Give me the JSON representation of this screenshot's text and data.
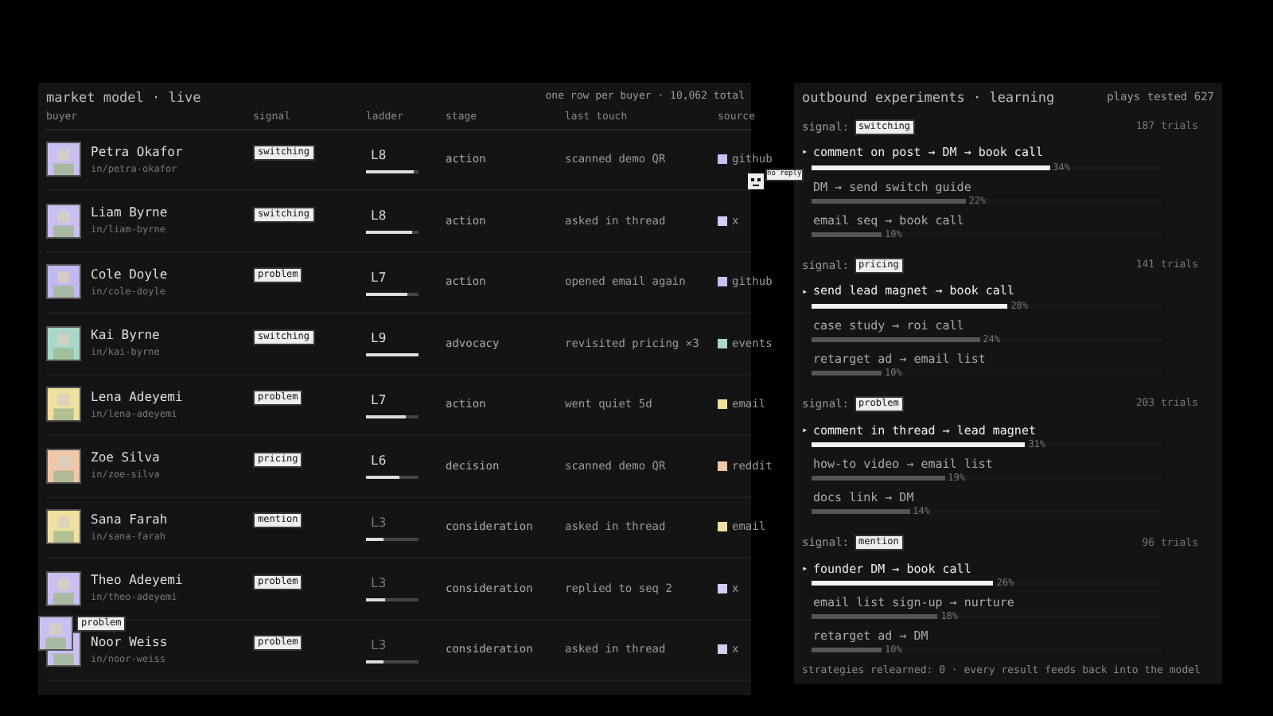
{
  "market": {
    "title": "market model · live",
    "summary": "one row per buyer · 10,062 total",
    "columns": [
      "buyer",
      "signal",
      "ladder",
      "stage",
      "last touch",
      "source"
    ],
    "rows": [
      {
        "name": "Petra Okafor",
        "handle": "in/petra-okafor",
        "color": "#c8c0f0",
        "signal": "switching",
        "ladder": "L8",
        "level": 0.9,
        "stage": "action",
        "last_touch": "scanned demo QR",
        "source": {
          "label": "github",
          "color": "#c8c0f0"
        }
      },
      {
        "name": "Liam Byrne",
        "handle": "in/liam-byrne",
        "color": "#c8c0f0",
        "signal": "switching",
        "ladder": "L8",
        "level": 0.88,
        "stage": "action",
        "last_touch": "asked in thread",
        "source": {
          "label": "x",
          "color": "#d4ccf4"
        }
      },
      {
        "name": "Cole Doyle",
        "handle": "in/cole-doyle",
        "color": "#c0b8f0",
        "signal": "problem",
        "ladder": "L7",
        "level": 0.8,
        "stage": "action",
        "last_touch": "opened email again",
        "source": {
          "label": "github",
          "color": "#c8c0f0"
        }
      },
      {
        "name": "Kai Byrne",
        "handle": "in/kai-byrne",
        "color": "#a8d8c8",
        "signal": "switching",
        "ladder": "L9",
        "level": 1.0,
        "stage": "advocacy",
        "last_touch": "revisited pricing ×3",
        "source": {
          "label": "events",
          "color": "#a8d8c8"
        }
      },
      {
        "name": "Lena Adeyemi",
        "handle": "in/lena-adeyemi",
        "color": "#f0e0a0",
        "signal": "problem",
        "ladder": "L7",
        "level": 0.75,
        "stage": "action",
        "last_touch": "went quiet 5d",
        "source": {
          "label": "email",
          "color": "#f0e0a0"
        }
      },
      {
        "name": "Zoe Silva",
        "handle": "in/zoe-silva",
        "color": "#f0c8a8",
        "signal": "pricing",
        "ladder": "L6",
        "level": 0.63,
        "stage": "decision",
        "last_touch": "scanned demo QR",
        "source": {
          "label": "reddit",
          "color": "#f0c8a8"
        }
      },
      {
        "name": "Sana Farah",
        "handle": "in/sana-farah",
        "color": "#f0e0a0",
        "signal": "mention",
        "ladder": "L3",
        "level": 0.33,
        "stage": "consideration",
        "last_touch": "asked in thread",
        "source": {
          "label": "email",
          "color": "#f0e0a0"
        }
      },
      {
        "name": "Theo Adeyemi",
        "handle": "in/theo-adeyemi",
        "color": "#c8c0f0",
        "signal": "problem",
        "ladder": "L3",
        "level": 0.36,
        "stage": "consideration",
        "last_touch": "replied to seq 2",
        "source": {
          "label": "x",
          "color": "#d4ccf4"
        }
      },
      {
        "name": "Noor Weiss",
        "handle": "in/noor-weiss",
        "color": "#c8c0f0",
        "signal": "problem",
        "ladder": "L3",
        "level": 0.33,
        "stage": "consideration",
        "last_touch": "asked in thread",
        "source": {
          "label": "x",
          "color": "#d4ccf4"
        }
      }
    ]
  },
  "floating": [
    {
      "kind": "face",
      "tag": "no reply"
    },
    {
      "kind": "avatar",
      "tag": "problem",
      "color": "#c8c0f0"
    }
  ],
  "experiments": {
    "title": "outbound experiments · learning",
    "summary": "plays tested 627",
    "groups": [
      {
        "label": "signal:",
        "signal": "switching",
        "trials": "187 trials",
        "plays": [
          {
            "marker": "▸",
            "label": "comment on post → DM → book call",
            "selected": true,
            "level": 0.68,
            "pct": "34%"
          },
          {
            "label": "DM → send switch guide",
            "selected": false,
            "level": 0.44,
            "pct": "22%"
          },
          {
            "label": "email seq → book call",
            "selected": false,
            "level": 0.2,
            "pct": "10%"
          }
        ]
      },
      {
        "label": "signal:",
        "signal": "pricing",
        "trials": "141 trials",
        "plays": [
          {
            "marker": "▸",
            "label": "send lead magnet → book call",
            "selected": true,
            "level": 0.56,
            "pct": "28%"
          },
          {
            "label": "case study → roi call",
            "selected": false,
            "level": 0.48,
            "pct": "24%"
          },
          {
            "label": "retarget ad → email list",
            "selected": false,
            "level": 0.2,
            "pct": "10%"
          }
        ]
      },
      {
        "label": "signal:",
        "signal": "problem",
        "trials": "203 trials",
        "plays": [
          {
            "marker": "▸",
            "label": "comment in thread → lead magnet",
            "selected": true,
            "level": 0.61,
            "pct": "31%"
          },
          {
            "label": "how-to video → email list",
            "selected": false,
            "level": 0.38,
            "pct": "19%"
          },
          {
            "label": "docs link → DM",
            "selected": false,
            "level": 0.28,
            "pct": "14%"
          }
        ]
      },
      {
        "label": "signal:",
        "signal": "mention",
        "trials": "96 trials",
        "plays": [
          {
            "marker": "▸",
            "label": "founder DM → book call",
            "selected": true,
            "level": 0.52,
            "pct": "26%"
          },
          {
            "label": "email list sign-up → nurture",
            "selected": false,
            "level": 0.36,
            "pct": "18%"
          },
          {
            "label": "retarget ad → DM",
            "selected": false,
            "level": 0.2,
            "pct": "10%"
          }
        ]
      }
    ],
    "footer": "strategies relearned: 0 · every result feeds back into the model"
  }
}
